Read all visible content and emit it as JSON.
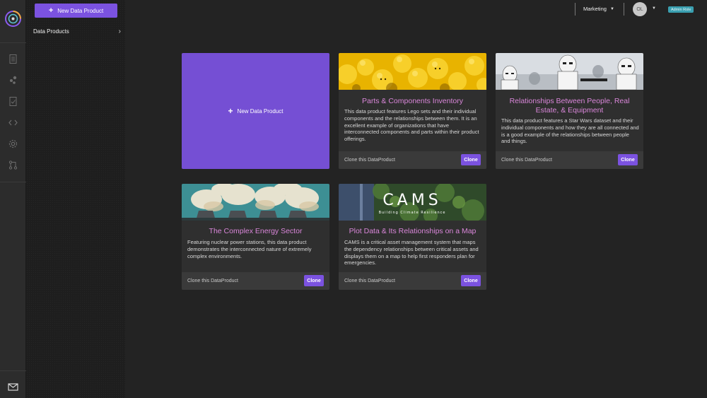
{
  "sidebar": {
    "new_button_label": "New Data Product",
    "items": [
      {
        "label": "Data Products"
      }
    ]
  },
  "rail": {
    "icons": [
      "logo-icon",
      "document-icon",
      "nodes-icon",
      "check-document-icon",
      "code-icon",
      "settings-icon",
      "git-icon",
      "mail-icon"
    ]
  },
  "header": {
    "workspace": "Marketing",
    "avatar_initials": "OL",
    "role_badge": "Admin Role"
  },
  "new_card": {
    "label": "New Data Product"
  },
  "cards": [
    {
      "title": "Parts & Components Inventory",
      "description": "This data product features Lego sets and their individual components and the relationships between them. It is an excellent example of organizations that have interconnected components and parts within their product offerings.",
      "clone_text": "Clone this DataProduct",
      "clone_label": "Clone"
    },
    {
      "title": "Relationships Between People, Real Estate, & Equipment",
      "description": "This data product features a Star Wars dataset and their individual components and how they are all connected and is a good example of the relationships between people and things.",
      "clone_text": "Clone this DataProduct",
      "clone_label": "Clone"
    },
    {
      "title": "The Complex Energy Sector",
      "description": "Featuring nuclear power stations, this data product demonstrates the interconnected nature of extremely complex environments.",
      "clone_text": "Clone this DataProduct",
      "clone_label": "Clone"
    },
    {
      "title": "Plot Data & Its Relationships on a Map",
      "description": "CAMS is a critical asset management system that maps the dependency relationships between critical assets and displays them on a map to help first responders plan for emergencies.",
      "clone_text": "Clone this DataProduct",
      "clone_label": "Clone",
      "image_text": "CAMS",
      "image_subtext": "Building Climate Resilience"
    }
  ],
  "colors": {
    "accent": "#7b52e0",
    "title": "#d986d9",
    "badge": "#3a9fb0"
  }
}
